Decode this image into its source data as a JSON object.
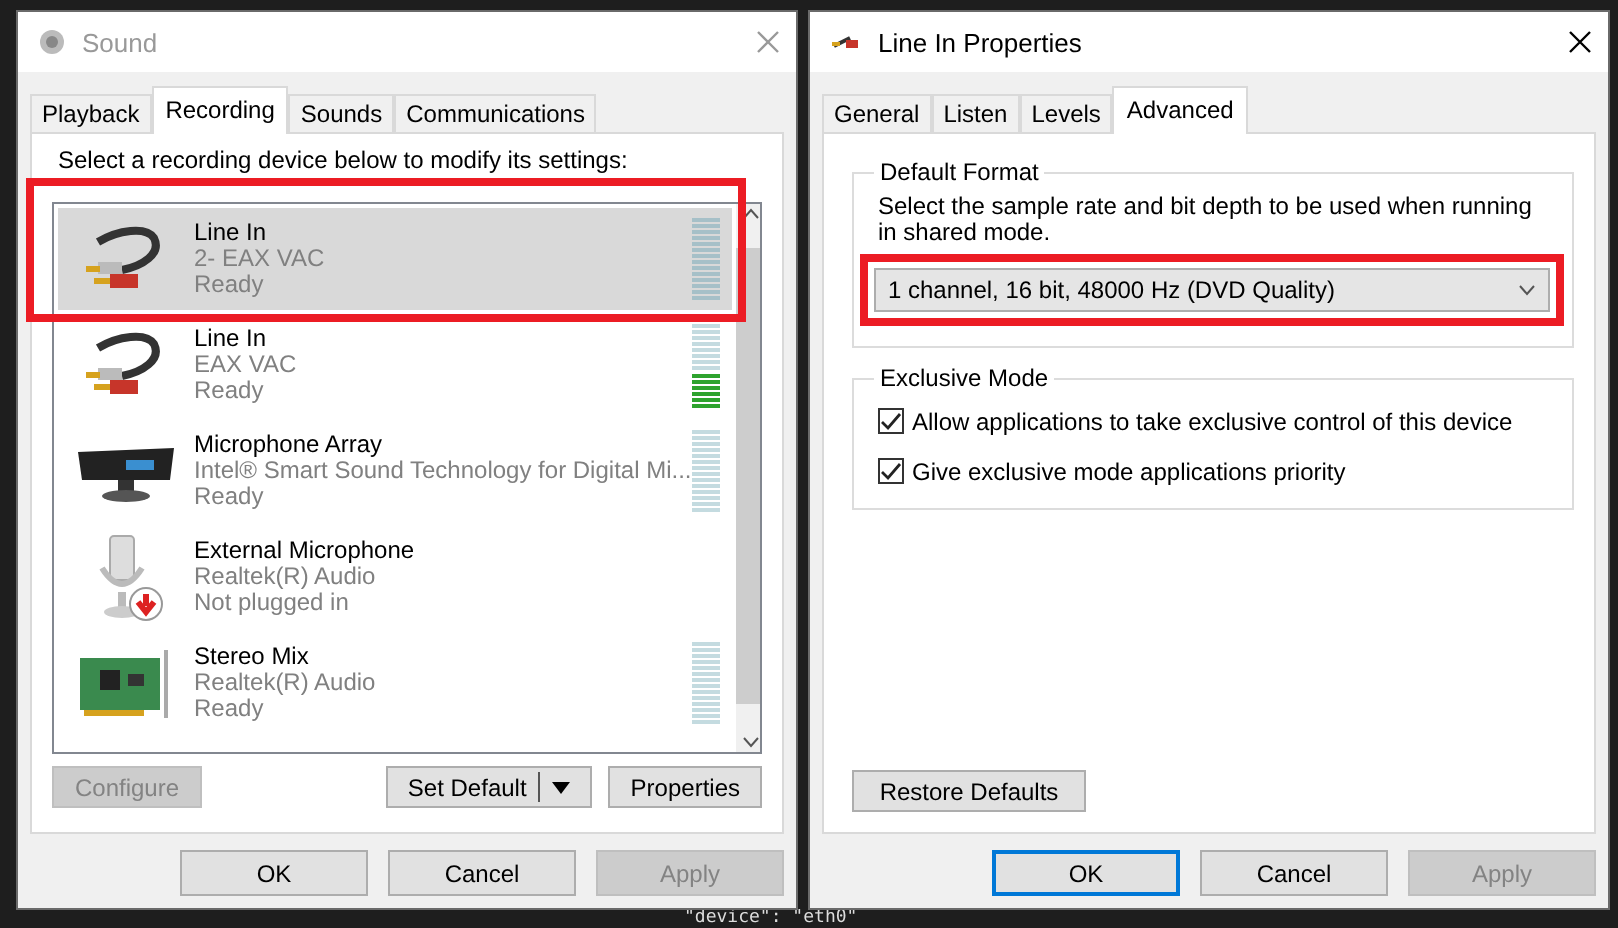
{
  "background": {
    "code_line": "\"device\": \"eth0\""
  },
  "sound_window": {
    "title": "Sound",
    "active": false,
    "tabs": [
      {
        "label": "Playback",
        "selected": false
      },
      {
        "label": "Recording",
        "selected": true
      },
      {
        "label": "Sounds",
        "selected": false
      },
      {
        "label": "Communications",
        "selected": false
      }
    ],
    "instruction": "Select a recording device below to modify its settings:",
    "devices": [
      {
        "kind": "cable",
        "name": "Line In",
        "driver": "2- EAX VAC",
        "status": "Ready",
        "selected": true,
        "highlighted": true,
        "meter": true,
        "level": 0
      },
      {
        "kind": "cable",
        "name": "Line In",
        "driver": "EAX VAC",
        "status": "Ready",
        "selected": false,
        "highlighted": false,
        "meter": true,
        "level": 0.45
      },
      {
        "kind": "array",
        "name": "Microphone Array",
        "driver": "Intel® Smart Sound Technology for Digital Mi...",
        "status": "Ready",
        "selected": false,
        "highlighted": false,
        "meter": true,
        "level": 0
      },
      {
        "kind": "mic",
        "name": "External Microphone",
        "driver": "Realtek(R) Audio",
        "status": "Not plugged in",
        "selected": false,
        "highlighted": false,
        "meter": false
      },
      {
        "kind": "card",
        "name": "Stereo Mix",
        "driver": "Realtek(R) Audio",
        "status": "Ready",
        "selected": false,
        "highlighted": false,
        "meter": true,
        "level": 0
      }
    ],
    "buttons": [
      {
        "label": "Configure",
        "disabled": true
      },
      {
        "label": "Set Default",
        "disabled": false,
        "split": true
      },
      {
        "label": "Properties",
        "disabled": false
      }
    ],
    "footer": [
      {
        "label": "OK",
        "disabled": false,
        "focused": false
      },
      {
        "label": "Cancel",
        "disabled": false,
        "focused": false
      },
      {
        "label": "Apply",
        "disabled": true,
        "focused": false
      }
    ]
  },
  "properties_window": {
    "title": "Line In Properties",
    "active": true,
    "tabs": [
      {
        "label": "General",
        "selected": false
      },
      {
        "label": "Listen",
        "selected": false
      },
      {
        "label": "Levels",
        "selected": false
      },
      {
        "label": "Advanced",
        "selected": true
      }
    ],
    "default_format": {
      "legend": "Default Format",
      "description": "Select the sample rate and bit depth to be used when running in shared mode.",
      "value": "1 channel, 16 bit, 48000 Hz (DVD Quality)",
      "highlighted": true
    },
    "exclusive_mode": {
      "legend": "Exclusive Mode",
      "options": [
        {
          "label": "Allow applications to take exclusive control of this device",
          "checked": true
        },
        {
          "label": "Give exclusive mode applications priority",
          "checked": true
        }
      ]
    },
    "restore_button": "Restore Defaults",
    "footer": [
      {
        "label": "OK",
        "disabled": false,
        "focused": true
      },
      {
        "label": "Cancel",
        "disabled": false,
        "focused": false
      },
      {
        "label": "Apply",
        "disabled": true,
        "focused": false
      }
    ]
  }
}
